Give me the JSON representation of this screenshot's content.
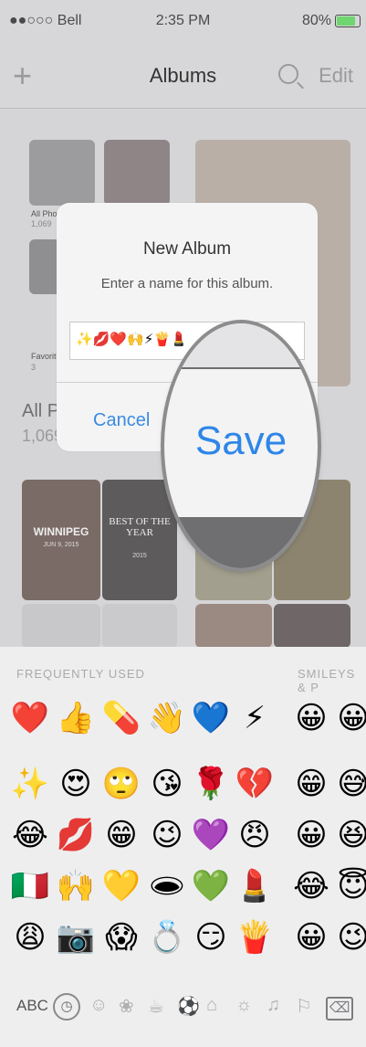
{
  "status": {
    "carrier": "●●○○○ Bell",
    "wifi_icon": "wifi-icon",
    "time": "2:35 PM",
    "battery_pct": "80%"
  },
  "nav": {
    "title": "Albums",
    "edit": "Edit",
    "add_icon": "+"
  },
  "albums": {
    "all_photos_small": "All Photos",
    "all_photos_count_small": "1,069",
    "favorites_small": "Favorites",
    "favorites_count_small": "3",
    "all_label": "All Ph",
    "all_count": "1,069",
    "winnipeg": "WINNIPEG",
    "winnipeg_date": "JUN 9, 2015",
    "best_title": "BEST OF THE YEAR",
    "best_year": "2015"
  },
  "dialog": {
    "title": "New Album",
    "subtitle": "Enter a name for this album.",
    "input_value": "✨💋❤️🙌⚡🍟💄",
    "cancel": "Cancel",
    "save": "Save"
  },
  "keyboard": {
    "category_left": "FREQUENTLY USED",
    "category_right": "SMILEYS & P",
    "emoji_rows": [
      [
        "❤️",
        "👍",
        "💊",
        "👋",
        "💙",
        "⚡",
        "😀",
        "😀"
      ],
      [
        "✨",
        "😍",
        "🙄",
        "😘",
        "🌹",
        "💔",
        "😁",
        "😅"
      ],
      [
        "😂",
        "💋",
        "😁",
        "😉",
        "💜",
        "😠",
        "😀",
        "😆"
      ],
      [
        "🇮🇹",
        "🙌",
        "💛",
        "🕳",
        "💚",
        "💄",
        "😂",
        "😇"
      ],
      [
        "😩",
        "📷",
        "😱",
        "💍",
        "😏",
        "🍟",
        "😀",
        "😉"
      ]
    ],
    "abc": "ABC",
    "delete": "⌫"
  }
}
